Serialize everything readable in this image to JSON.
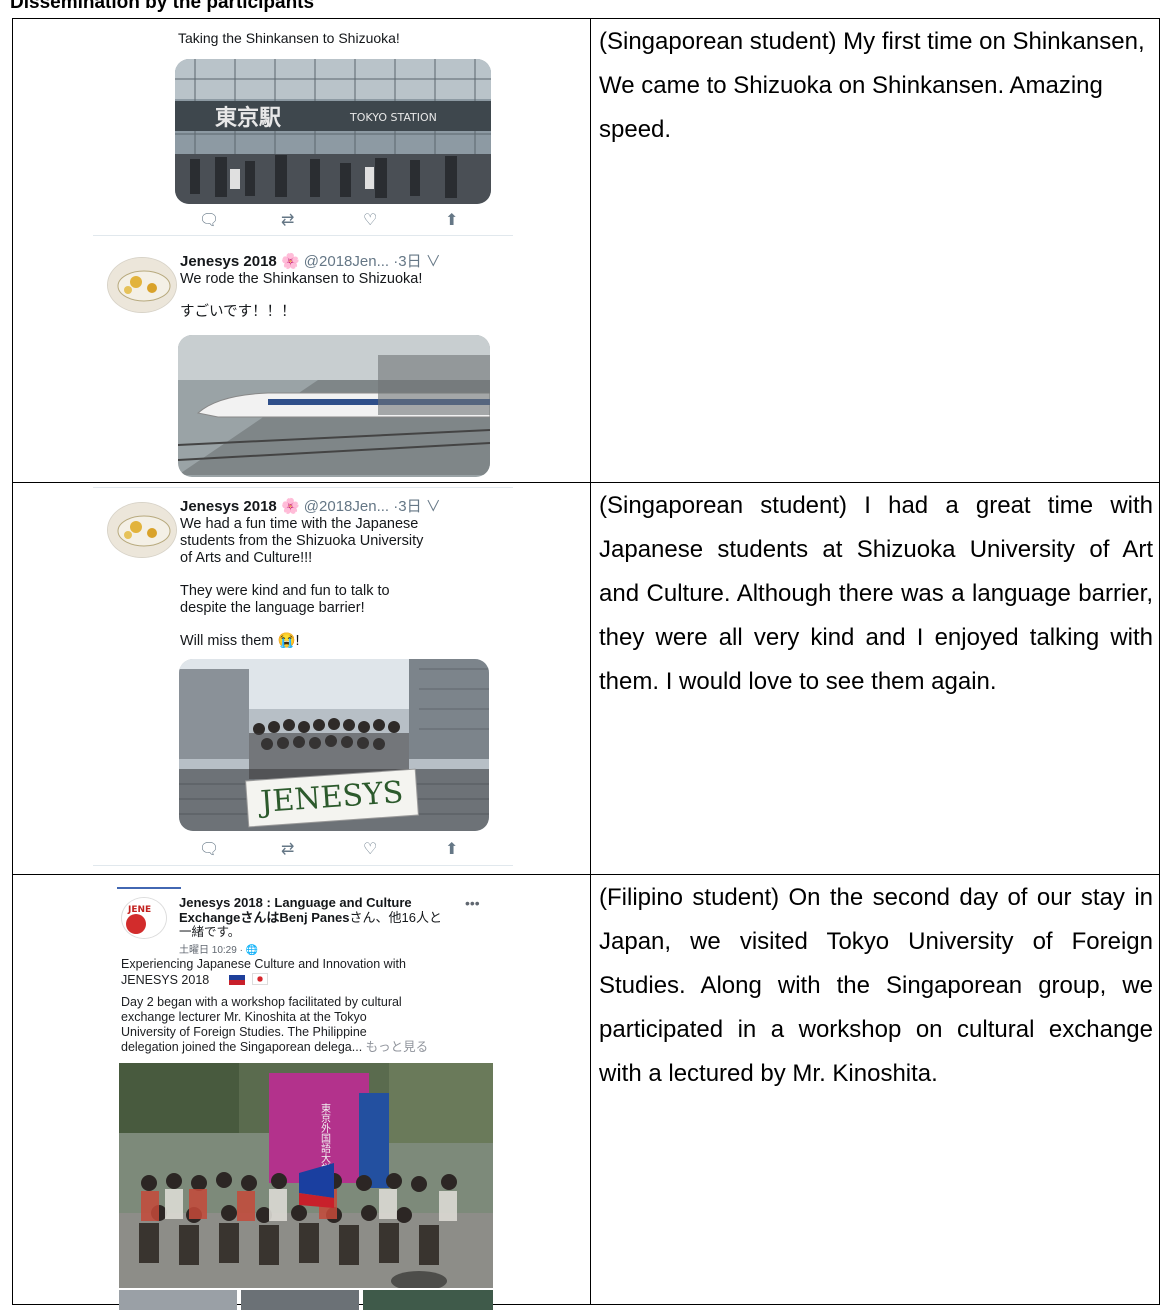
{
  "heading": "Dissemination by the participants",
  "rows": [
    {
      "left": {
        "tweet1_text": "Taking the Shinkansen to Shizuoka!",
        "photo1_sign": "東京駅",
        "photo1_sign_en": "TOKYO STATION",
        "tweet2_name": "Jenesys 2018",
        "tweet2_flower": "🌸",
        "tweet2_handle": "@2018Jen... ·3日 ∨",
        "tweet2_line1": "We rode the Shinkansen to Shizuoka!",
        "tweet2_line2": "すごいです！！！"
      },
      "right": "(Singaporean student) My first time on Shinkansen, We came to Shizuoka on Shinkansen. Amazing speed."
    },
    {
      "left": {
        "name": "Jenesys 2018",
        "flower": "🌸",
        "handle": "@2018Jen... ·3日 ∨",
        "line1": "We had a fun time with the Japanese",
        "line2": "students from the Shizuoka University",
        "line3": "of Arts and Culture!!!",
        "line4": "They were kind and fun to talk to",
        "line5": "despite the language barrier!",
        "line6": "Will miss them 😭!",
        "banner": "JENESYS"
      },
      "right": "(Singaporean student) I had a great time with Japanese students at Shizuoka University of Art and Culture.  Although there was a language barrier, they were all very kind and I enjoyed talking with them. I would love to see them again."
    },
    {
      "left": {
        "title1": "Jenesys 2018 : Language and Culture",
        "title2": "Exchangeさんは",
        "title2b": "Benj Panes",
        "title2c": "さん、他16人と",
        "title3": "一緒です。",
        "time": "土曜日 10:29 · 🌐",
        "more_menu": "•••",
        "line1": "Experiencing Japanese Culture and Innovation with",
        "line2": "JENESYS 2018",
        "line3": "Day 2 began with a workshop facilitated by cultural",
        "line4": "exchange lecturer Mr. Kinoshita at the Tokyo",
        "line5": "University of Foreign Studies. The Philippine",
        "line6": "delegation joined the Singaporean delega...",
        "see_more": "もっと見る",
        "sign_text": "東京外国語大学"
      },
      "right": "(Filipino student) On the second day of our stay in Japan, we visited Tokyo University of Foreign Studies. Along with the Singaporean group, we participated in a workshop on cultural exchange with a lectured by Mr. Kinoshita."
    }
  ],
  "colors": {
    "tweet_text": "#14171a",
    "tweet_muted": "#657786",
    "border": "#000000",
    "fb_blue": "#385898"
  },
  "icons": [
    "reply-icon",
    "retweet-icon",
    "like-icon",
    "share-icon",
    "globe-icon",
    "flag-philippines-icon",
    "flag-japan-icon"
  ]
}
